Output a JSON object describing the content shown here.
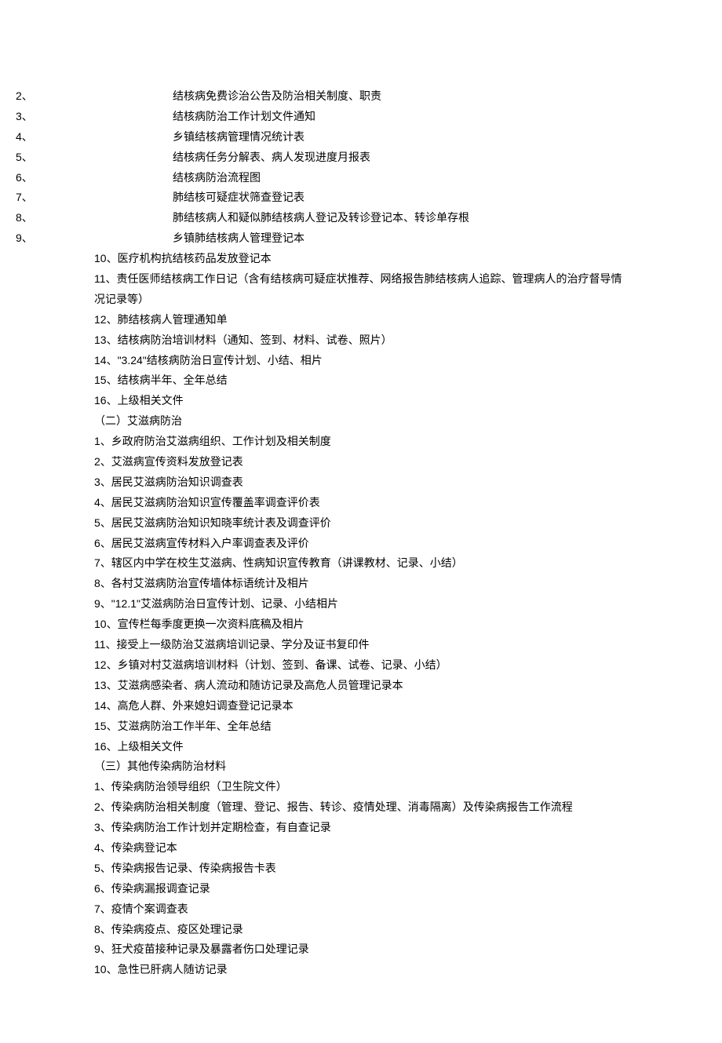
{
  "section_a": {
    "items": [
      {
        "num": "2、",
        "text": "结核病免费诊治公告及防治相关制度、职责"
      },
      {
        "num": "3、",
        "text": "结核病防治工作计划文件通知"
      },
      {
        "num": "4、",
        "text": "乡镇结核病管理情况统计表"
      },
      {
        "num": "5、",
        "text": "结核病任务分解表、病人发现进度月报表"
      },
      {
        "num": "6、",
        "text": "结核病防治流程图"
      },
      {
        "num": "7、",
        "text": "肺结核可疑症状筛查登记表"
      },
      {
        "num": "8、",
        "text": "肺结核病人和疑似肺结核病人登记及转诊登记本、转诊单存根"
      },
      {
        "num": "9、",
        "text": "乡镇肺结核病人管理登记本"
      }
    ],
    "items_plain": [
      "10、医疗机构抗结核药品发放登记本",
      "11、责任医师结核病工作日记（含有结核病可疑症状推荐、网络报告肺结核病人追踪、管理病人的治疗督导情况记录等）",
      "12、肺结核病人管理通知单",
      "13、结核病防治培训材料（通知、签到、材料、试卷、照片）",
      "14、\"3.24\"结核病防治日宣传计划、小结、相片",
      "15、结核病半年、全年总结",
      "16、上级相关文件"
    ]
  },
  "section_b": {
    "title": "（二）艾滋病防治",
    "items": [
      "1、乡政府防治艾滋病组织、工作计划及相关制度",
      "2、艾滋病宣传资料发放登记表",
      "3、居民艾滋病防治知识调查表",
      "4、居民艾滋病防治知识宣传覆盖率调查评价表",
      "5、居民艾滋病防治知识知晓率统计表及调查评价",
      "6、居民艾滋病宣传材料入户率调查表及评价",
      "7、辖区内中学在校生艾滋病、性病知识宣传教育（讲课教材、记录、小结）",
      "8、各村艾滋病防治宣传墙体标语统计及相片",
      "9、\"12.1\"艾滋病防治日宣传计划、记录、小结相片",
      "10、宣传栏每季度更换一次资料底稿及相片",
      "11、接受上一级防治艾滋病培训记录、学分及证书复印件",
      "12、乡镇对村艾滋病培训材料（计划、签到、备课、试卷、记录、小结）",
      "13、艾滋病感染者、病人流动和随访记录及高危人员管理记录本",
      "14、高危人群、外来媳妇调查登记记录本",
      "15、艾滋病防治工作半年、全年总结",
      "16、上级相关文件"
    ]
  },
  "section_c": {
    "title": "（三）其他传染病防治材料",
    "items": [
      "1、传染病防治领导组织（卫生院文件）",
      "2、传染病防治相关制度（管理、登记、报告、转诊、疫情处理、消毒隔离）及传染病报告工作流程",
      "3、传染病防治工作计划并定期检查，有自查记录",
      "4、传染病登记本",
      "5、传染病报告记录、传染病报告卡表",
      "6、传染病漏报调查记录",
      "7、疫情个案调查表",
      "8、传染病疫点、疫区处理记录",
      "9、狂犬疫苗接种记录及暴露者伤口处理记录",
      "10、急性已肝病人随访记录"
    ]
  }
}
